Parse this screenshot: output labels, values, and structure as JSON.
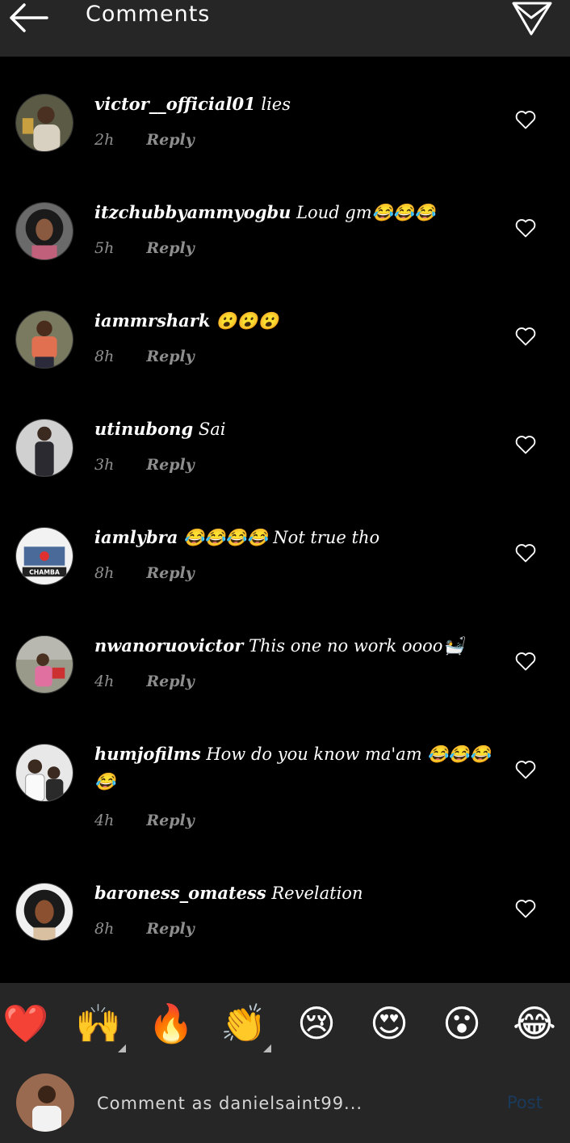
{
  "header": {
    "title": "Comments",
    "back_icon": "arrow-left-icon",
    "send_icon": "paper-plane-icon"
  },
  "comments": [
    {
      "username": "victor__official01",
      "text": "lies",
      "time": "2h",
      "reply": "Reply"
    },
    {
      "username": "itzchubbyammyogbu",
      "text": "Loud gm😂😂😂",
      "time": "5h",
      "reply": "Reply"
    },
    {
      "username": "iammrshark",
      "text": "😮😮😮",
      "time": "8h",
      "reply": "Reply"
    },
    {
      "username": "utinubong",
      "text": "Sai",
      "time": "3h",
      "reply": "Reply"
    },
    {
      "username": "iamlybra",
      "text": "😂😂😂😂 Not true tho",
      "time": "8h",
      "reply": "Reply"
    },
    {
      "username": "nwanoruovictor",
      "text": "This one no work oooo🛀",
      "time": "4h",
      "reply": "Reply"
    },
    {
      "username": "humjofilms",
      "text": "How do you know ma'am 😂😂😂 😂",
      "time": "4h",
      "reply": "Reply"
    },
    {
      "username": "baroness_omatess",
      "text": "Revelation",
      "time": "8h",
      "reply": "Reply"
    }
  ],
  "avatar_badge_text": "CHAMBA",
  "reactions": [
    "❤️",
    "🙌",
    "🔥",
    "👏",
    "😢",
    "😍",
    "😮",
    "😂"
  ],
  "composer": {
    "placeholder": "Comment as danielsaint99...",
    "post_label": "Post",
    "post_color": "#1a3a5c"
  },
  "colors": {
    "header_bg": "#262626",
    "background": "#000000",
    "meta_text": "#8e8e8e"
  }
}
